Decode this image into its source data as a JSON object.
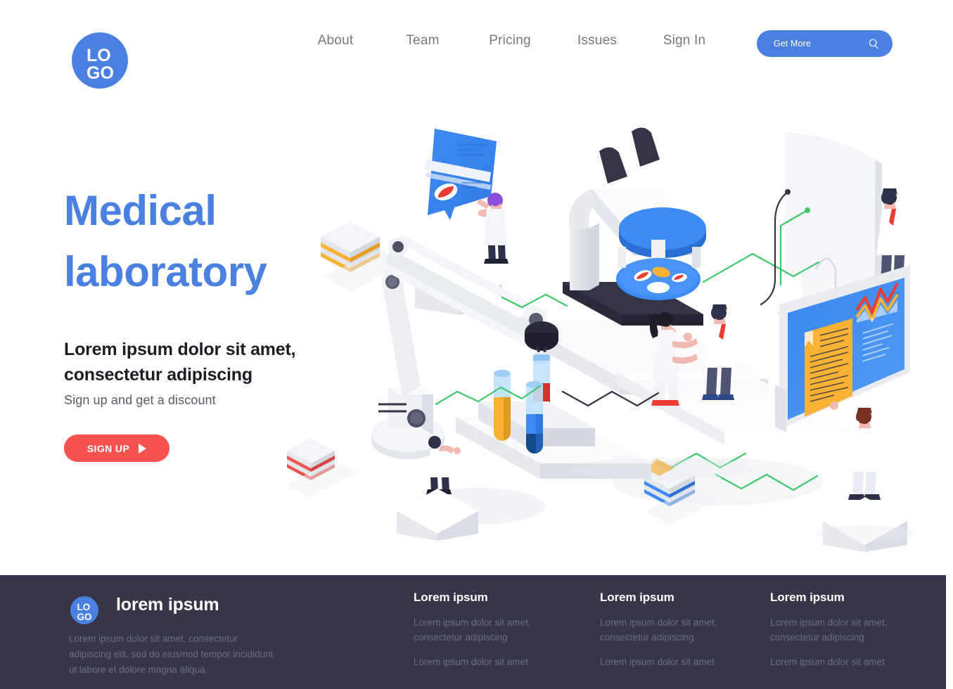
{
  "brand": {
    "logo_top": "LO",
    "logo_bottom": "GO",
    "color": "#4a80e0"
  },
  "header": {
    "nav": [
      {
        "label": "About"
      },
      {
        "label": "Team"
      },
      {
        "label": "Pricing"
      },
      {
        "label": "Issues"
      },
      {
        "label": "Sign In"
      }
    ],
    "cta": {
      "label": "Get More",
      "icon": "search-icon",
      "bg_color": "#4a80e0"
    }
  },
  "hero": {
    "title_line1": "Medical",
    "title_line2": "laboratory",
    "title_color": "#4a80e0",
    "subtitle_line1": "Lorem ipsum dolor sit amet,",
    "subtitle_line2": "consectetur adipiscing",
    "note": "Sign up and get a discount",
    "signup": {
      "label": "SIGN UP",
      "icon": "play-triangle-icon",
      "bg_color": "#f8524f"
    }
  },
  "illustration": {
    "name": "isometric-medical-laboratory-scene",
    "elements": [
      "microscope",
      "robotic-arm",
      "test-tube-rack",
      "curved-monitor",
      "blue-display-screen",
      "pill-speech-bubble",
      "scientist-characters",
      "sample-box-stacks"
    ],
    "colors": {
      "blue": "#3d8bf5",
      "light_blue": "#6fb7f7",
      "dark": "#353547",
      "yellow": "#f7b42c",
      "red": "#ee3b33",
      "green_wire": "#3ec96a",
      "white_panel": "#f2f3f6"
    }
  },
  "footer": {
    "bg_color": "#363648",
    "brand_name": "lorem ipsum",
    "description": "Lorem ipsum dolor sit amet, consectetur adipiscing elit, sed do eiusmod tempor incididunt ut labore et dolore magna aliqua.",
    "columns": [
      {
        "title": "Lorem ipsum",
        "links": [
          "Lorem ipsum dolor sit amet, consectetur adipiscing",
          "Lorem ipsum dolor sit amet"
        ]
      },
      {
        "title": "Lorem ipsum",
        "links": [
          "Lorem ipsum dolor sit amet, consectetur adipiscing",
          "Lorem ipsum dolor sit amet"
        ]
      },
      {
        "title": "Lorem ipsum",
        "links": [
          "Lorem ipsum dolor sit amet, consectetur adipiscing",
          "Lorem ipsum dolor sit amet"
        ]
      }
    ]
  }
}
